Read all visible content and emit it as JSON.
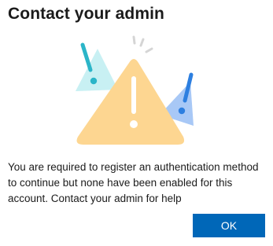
{
  "dialog": {
    "title": "Contact your admin",
    "message": "You are required to register an authentication method to continue but none have been enabled for this account. Contact your admin for help",
    "ok_label": "OK"
  },
  "illustration": {
    "icon": "warning-triangle-icon",
    "colors": {
      "main_triangle": "#fdd691",
      "left_triangle": "#c8f0f3",
      "left_exclamation": "#2bb5c8",
      "right_triangle": "#a8c8f6",
      "right_exclamation": "#2d7fe0",
      "burst_lines": "#d5d5d5",
      "main_exclamation": "#ffffff"
    }
  },
  "colors": {
    "primary_button": "#0067b8",
    "text": "#1b1b1b",
    "background": "#ffffff"
  }
}
